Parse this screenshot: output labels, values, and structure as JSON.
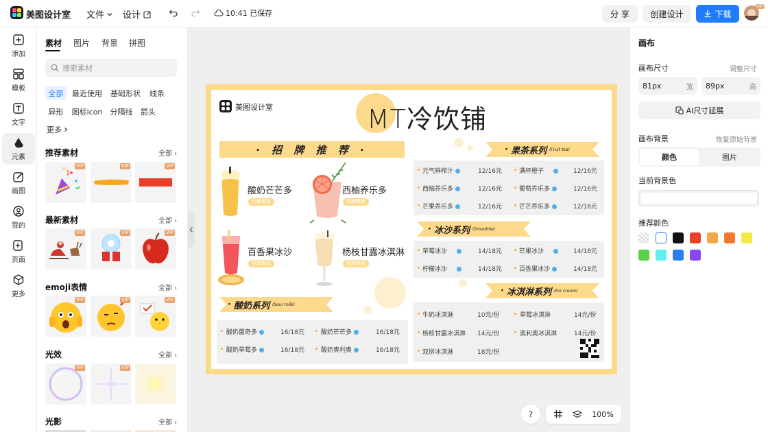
{
  "topbar": {
    "app_name": "美图设计室",
    "file_menu": "文件",
    "design_menu": "设计",
    "save_status": "10:41 已保存",
    "share": "分 享",
    "create_design": "创建设计",
    "download": "下载"
  },
  "rail": [
    {
      "label": "添加",
      "icon": "add-icon"
    },
    {
      "label": "模板",
      "icon": "template-icon"
    },
    {
      "label": "文字",
      "icon": "text-icon"
    },
    {
      "label": "元素",
      "icon": "element-icon"
    },
    {
      "label": "画图",
      "icon": "draw-icon"
    },
    {
      "label": "我的",
      "icon": "user-icon"
    },
    {
      "label": "页面",
      "icon": "page-icon"
    },
    {
      "label": "更多",
      "icon": "more-icon"
    }
  ],
  "panel": {
    "tabs": [
      "素材",
      "图片",
      "背景",
      "拼图"
    ],
    "search_placeholder": "搜索素材",
    "chips": [
      "全部",
      "最近使用",
      "基础形状",
      "线条",
      "异形",
      "图标icon",
      "分隔线",
      "箭头",
      "更多"
    ],
    "sections": [
      {
        "title": "推荐素材",
        "more": "全部"
      },
      {
        "title": "最新素材",
        "more": "全部"
      },
      {
        "title": "emoji表情",
        "more": "全部"
      },
      {
        "title": "光效",
        "more": "全部"
      },
      {
        "title": "光影",
        "more": "全部"
      }
    ],
    "vip_badge": "VIP"
  },
  "menu": {
    "brand": "美图设计室",
    "title": "MT冷饮铺",
    "signature_banner": "· 招 牌 推 荐 ·",
    "signature_items": [
      {
        "name": "酸奶芒芒多",
        "tag": "招牌推荐"
      },
      {
        "name": "西柚养乐多",
        "tag": "招牌推荐"
      },
      {
        "name": "百香果冰沙",
        "tag": "招牌推荐"
      },
      {
        "name": "杨枝甘露冰淇淋",
        "tag": "招牌推荐"
      }
    ],
    "yogurt": {
      "title": "酸奶系列",
      "sub": "(Sour milk)",
      "items": [
        {
          "name": "酸奶菌奇多",
          "price": "16/18元"
        },
        {
          "name": "酸奶芒芒多",
          "price": "16/18元"
        },
        {
          "name": "酸奶草莓多",
          "price": "16/18元"
        },
        {
          "name": "酸奶奥利奥",
          "price": "16/18元"
        }
      ]
    },
    "fruit_tea": {
      "title": "果茶系列",
      "sub": "(Fruit tea)",
      "items": [
        {
          "name": "元气鲜榨汁",
          "price": "12/16元"
        },
        {
          "name": "满杯橙子",
          "price": "12/16元"
        },
        {
          "name": "西柚养乐多",
          "price": "12/16元"
        },
        {
          "name": "葡萄养乐多",
          "price": "12/16元"
        },
        {
          "name": "芒果养乐多",
          "price": "12/16元"
        },
        {
          "name": "芒芒养乐多",
          "price": "12/16元"
        }
      ]
    },
    "smoothie": {
      "title": "冰沙系列",
      "sub": "(Smoothie)",
      "items": [
        {
          "name": "草莓冰沙",
          "price": "14/18元"
        },
        {
          "name": "芒果冰沙",
          "price": "14/18元"
        },
        {
          "name": "柠檬冰沙",
          "price": "14/18元"
        },
        {
          "name": "百香果冰沙",
          "price": "14/18元"
        }
      ]
    },
    "icecream": {
      "title": "冰淇淋系列",
      "sub": "(Ice cream)",
      "items": [
        {
          "name": "牛奶冰淇淋",
          "price": "10元/份"
        },
        {
          "name": "草莓冰淇淋",
          "price": "14元/份"
        },
        {
          "name": "杨枝甘露冰淇淋",
          "price": "14元/份"
        },
        {
          "name": "奥利奥冰淇淋",
          "price": "14元/份"
        },
        {
          "name": "双拼冰淇淋",
          "price": "18元/份"
        }
      ]
    }
  },
  "bottom_tools": {
    "help": "?",
    "zoom": "100%"
  },
  "right_panel": {
    "title": "画布",
    "size_label": "画布尺寸",
    "resize": "调整尺寸",
    "width_value": "81px",
    "width_unit": "宽",
    "height_value": "89px",
    "height_unit": "高",
    "ai_extend": "AI尺寸延展",
    "bg_label": "画布背景",
    "restore_bg": "恢复原始背景",
    "bg_tabs": [
      "颜色",
      "图片"
    ],
    "current_bg": "当前背景色",
    "recommend": "推荐颜色",
    "swatches": [
      "transparent",
      "#ffffff",
      "#111111",
      "#e8402a",
      "#f0a84a",
      "#f07a28",
      "#f7e84a",
      "#5bd14a",
      "#5ff0f0",
      "#2a7ff0",
      "#8a46f0"
    ]
  }
}
